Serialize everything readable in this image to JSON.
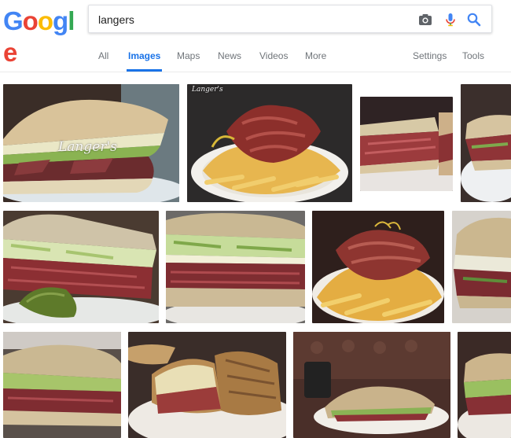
{
  "logo": {
    "letters": [
      "G",
      "o",
      "o",
      "g",
      "l",
      "e"
    ],
    "colors": [
      "#4285f4",
      "#ea4335",
      "#fbbc05",
      "#4285f4",
      "#34a853",
      "#ea4335"
    ]
  },
  "search": {
    "query": "langers",
    "camera_icon": "camera-icon",
    "mic_icon": "mic-icon",
    "search_icon": "magnifier-icon"
  },
  "tabs": {
    "all": "All",
    "images": "Images",
    "maps": "Maps",
    "news": "News",
    "videos": "Videos",
    "more": "More",
    "settings": "Settings",
    "tools": "Tools"
  },
  "results": {
    "watermark_main": "Langer's",
    "watermark_top": "Langer's"
  },
  "colors": {
    "accent": "#1a73e8",
    "tab_text": "#70757a"
  }
}
